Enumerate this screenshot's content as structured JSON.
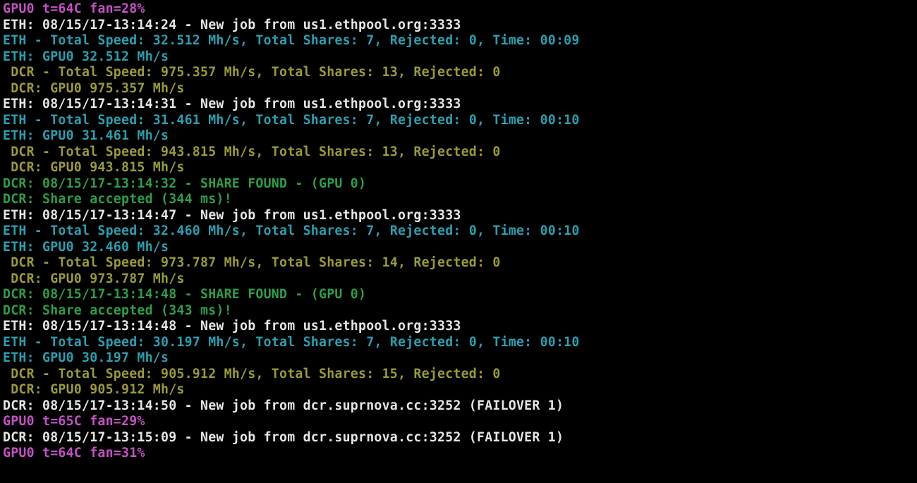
{
  "colors": {
    "magenta": "#c452c4",
    "white": "#e6e6e6",
    "cyan": "#2a9fb0",
    "olive": "#9a9a3a",
    "green": "#2e9e4a"
  },
  "lines": [
    {
      "color": "magenta",
      "text": "GPU0 t=64C fan=28%"
    },
    {
      "color": "white",
      "text": "ETH: 08/15/17-13:14:24 - New job from us1.ethpool.org:3333"
    },
    {
      "color": "cyan",
      "text": "ETH - Total Speed: 32.512 Mh/s, Total Shares: 7, Rejected: 0, Time: 00:09"
    },
    {
      "color": "cyan",
      "text": "ETH: GPU0 32.512 Mh/s"
    },
    {
      "color": "olive",
      "text": " DCR - Total Speed: 975.357 Mh/s, Total Shares: 13, Rejected: 0"
    },
    {
      "color": "olive",
      "text": " DCR: GPU0 975.357 Mh/s"
    },
    {
      "color": "white",
      "text": "ETH: 08/15/17-13:14:31 - New job from us1.ethpool.org:3333"
    },
    {
      "color": "cyan",
      "text": "ETH - Total Speed: 31.461 Mh/s, Total Shares: 7, Rejected: 0, Time: 00:10"
    },
    {
      "color": "cyan",
      "text": "ETH: GPU0 31.461 Mh/s"
    },
    {
      "color": "olive",
      "text": " DCR - Total Speed: 943.815 Mh/s, Total Shares: 13, Rejected: 0"
    },
    {
      "color": "olive",
      "text": " DCR: GPU0 943.815 Mh/s"
    },
    {
      "color": "green",
      "text": "DCR: 08/15/17-13:14:32 - SHARE FOUND - (GPU 0)"
    },
    {
      "color": "green",
      "text": "DCR: Share accepted (344 ms)!"
    },
    {
      "color": "white",
      "text": "ETH: 08/15/17-13:14:47 - New job from us1.ethpool.org:3333"
    },
    {
      "color": "cyan",
      "text": "ETH - Total Speed: 32.460 Mh/s, Total Shares: 7, Rejected: 0, Time: 00:10"
    },
    {
      "color": "cyan",
      "text": "ETH: GPU0 32.460 Mh/s"
    },
    {
      "color": "olive",
      "text": " DCR - Total Speed: 973.787 Mh/s, Total Shares: 14, Rejected: 0"
    },
    {
      "color": "olive",
      "text": " DCR: GPU0 973.787 Mh/s"
    },
    {
      "color": "green",
      "text": "DCR: 08/15/17-13:14:48 - SHARE FOUND - (GPU 0)"
    },
    {
      "color": "green",
      "text": "DCR: Share accepted (343 ms)!"
    },
    {
      "color": "white",
      "text": "ETH: 08/15/17-13:14:48 - New job from us1.ethpool.org:3333"
    },
    {
      "color": "cyan",
      "text": "ETH - Total Speed: 30.197 Mh/s, Total Shares: 7, Rejected: 0, Time: 00:10"
    },
    {
      "color": "cyan",
      "text": "ETH: GPU0 30.197 Mh/s"
    },
    {
      "color": "olive",
      "text": " DCR - Total Speed: 905.912 Mh/s, Total Shares: 15, Rejected: 0"
    },
    {
      "color": "olive",
      "text": " DCR: GPU0 905.912 Mh/s"
    },
    {
      "color": "white",
      "text": "DCR: 08/15/17-13:14:50 - New job from dcr.suprnova.cc:3252 (FAILOVER 1)"
    },
    {
      "color": "magenta",
      "text": "GPU0 t=65C fan=29%"
    },
    {
      "color": "white",
      "text": "DCR: 08/15/17-13:15:09 - New job from dcr.suprnova.cc:3252 (FAILOVER 1)"
    },
    {
      "color": "magenta",
      "text": "GPU0 t=64C fan=31%"
    }
  ]
}
